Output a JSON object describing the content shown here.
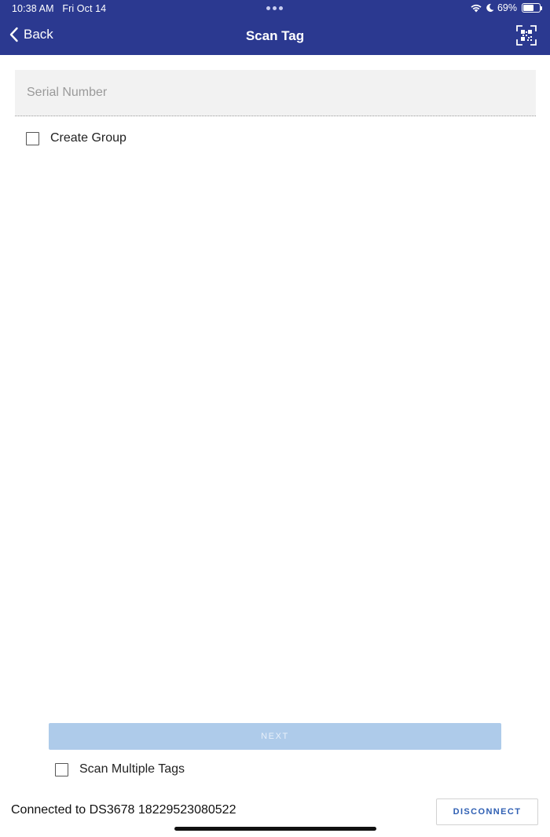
{
  "status_bar": {
    "time": "10:38 AM",
    "date": "Fri Oct 14",
    "battery_text": "69%",
    "battery_level": 0.69,
    "icons": [
      "wifi-icon",
      "moon-icon",
      "battery-icon"
    ]
  },
  "nav": {
    "back_label": "Back",
    "title": "Scan Tag",
    "action_icon": "qr-code-scan-icon"
  },
  "form": {
    "serial_placeholder": "Serial Number",
    "serial_value": "",
    "create_group_label": "Create Group",
    "create_group_checked": false
  },
  "footer": {
    "next_label": "NEXT",
    "next_enabled": false,
    "scan_multiple_label": "Scan Multiple Tags",
    "scan_multiple_checked": false,
    "connection_text": "Connected to DS3678 18229523080522",
    "disconnect_label": "DISCONNECT"
  },
  "colors": {
    "header_bg": "#2b3990",
    "next_disabled_bg": "#aecbea",
    "disconnect_text": "#2f5fb3"
  }
}
